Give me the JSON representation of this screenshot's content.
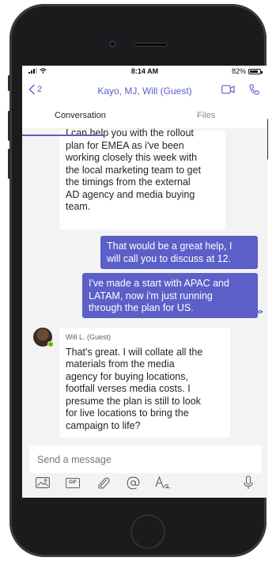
{
  "status_bar": {
    "time": "8:14 AM",
    "battery": "82%",
    "battery_level": 0.82
  },
  "header": {
    "back_count": "2",
    "title": "Kayo, MJ, Will (Guest)",
    "video_icon": "video-camera-icon",
    "call_icon": "phone-icon"
  },
  "tabs": [
    {
      "label": "Conversation",
      "active": true
    },
    {
      "label": "Files",
      "active": false
    }
  ],
  "messages": [
    {
      "type": "incoming",
      "lines": [
        "I can help you with the rollout",
        "plan for EMEA as i've been",
        "working closely this week with",
        "the local marketing team to get",
        "the timings from the external",
        "AD agency and media buying",
        "team."
      ]
    },
    {
      "type": "outgoing",
      "lines": [
        "That would be a great help, I",
        "will call you to discuss at 12."
      ]
    },
    {
      "type": "outgoing",
      "lines": [
        "I've made a start with APAC and",
        "LATAM, now i'm just running",
        "through the plan for US."
      ]
    },
    {
      "type": "incoming",
      "sender": "Will L. (Guest)",
      "lines": [
        "That's great. I will collate all the",
        "materials from the media",
        "agency for buying locations,",
        "footfall verses media costs. I",
        "presume the plan is still to look",
        "for live locations to bring the",
        "campaign to life?"
      ]
    }
  ],
  "compose": {
    "placeholder": "Send a message"
  },
  "toolbar": {
    "items": [
      "image-icon",
      "gif-icon",
      "attach-icon",
      "mention-icon",
      "format-icon",
      "microphone-icon"
    ],
    "gif_label": "GIF"
  },
  "colors": {
    "accent": "#5b5fc7",
    "background": "#f3f3f3",
    "bubble_incoming": "#ffffff",
    "presence_available": "#6bb700"
  }
}
